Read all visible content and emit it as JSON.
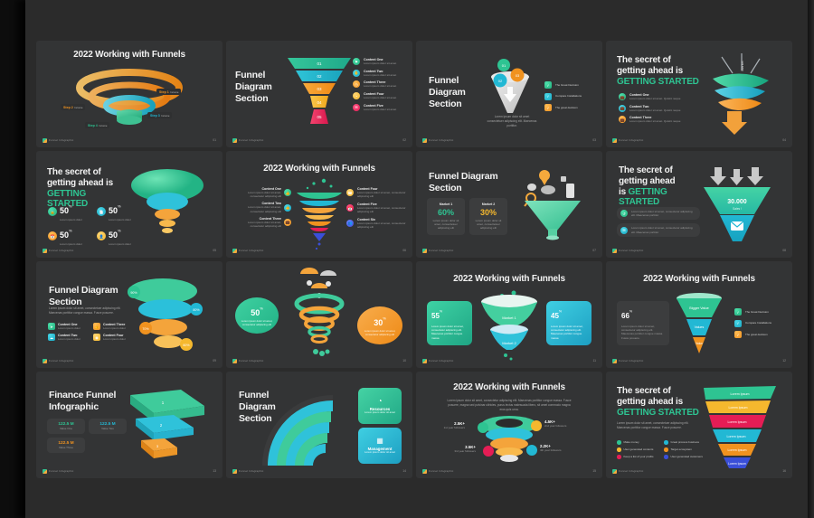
{
  "deck": {
    "footer_brand": "Funnel Infographic",
    "colors": {
      "green": "#2ec492",
      "teal": "#22b8d4",
      "orange": "#f0921f",
      "yellow": "#f5b82e",
      "pink": "#e51d55",
      "blue": "#3a4fd8",
      "slide_bg": "#333435",
      "page_bg": "#2b2b2b"
    },
    "lorem_short": "Lorem ipsum dolor sit amet",
    "lorem_mid": "Lorem ipsum dolor sit amet, consectetur adipiscing elit.",
    "lorem_long": "Lorem ipsum dolor sit amet, consectetur adipiscing elit. Maecenas porttitor congue massa. Fusce posuere."
  },
  "slides": [
    {
      "n": 1,
      "page": "01",
      "title": "2022 Working with Funnels",
      "ring_labels": [
        {
          "text": "Step 1",
          "sub": "Income",
          "color": "#f0921f"
        },
        {
          "text": "Step 2",
          "sub": "Income",
          "color": "#f0921f"
        },
        {
          "text": "Step 3",
          "sub": "Income",
          "color": "#22b8d4"
        },
        {
          "text": "Step 4",
          "sub": "Income",
          "color": "#2ec492"
        }
      ]
    },
    {
      "n": 2,
      "page": "02",
      "title": "Funnel Diagram Section",
      "steps": [
        "01",
        "02",
        "03",
        "04",
        "05"
      ],
      "legend": [
        {
          "label": "Content One",
          "desc": "Lorem ipsum dolor sit amet",
          "color": "#2ec492",
          "icon": "⚑"
        },
        {
          "label": "Content Two",
          "desc": "Lorem ipsum dolor sit amet",
          "color": "#22b8d4",
          "icon": "✋"
        },
        {
          "label": "Content Three",
          "desc": "Lorem ipsum dolor sit amet",
          "color": "#f0921f",
          "icon": "◴"
        },
        {
          "label": "Content Four",
          "desc": "Lorem ipsum dolor sit amet",
          "color": "#f5b82e",
          "icon": "◔"
        },
        {
          "label": "Content Five",
          "desc": "Lorem ipsum dolor sit amet",
          "color": "#e51d55",
          "icon": "✉"
        }
      ]
    },
    {
      "n": 3,
      "page": "03",
      "title": "Funnel Diagram Section",
      "caption": "Lorem ipsum dolor sit amet consectetuer adipiscing elit. Maecenas porttitor.",
      "bubbles": [
        {
          "label": "01",
          "color": "#2ec492"
        },
        {
          "label": "02",
          "color": "#22b8d4"
        },
        {
          "label": "03",
          "color": "#f0921f"
        }
      ],
      "legend": [
        {
          "label": "The Great Decision",
          "color": "#2ec492"
        },
        {
          "label": "Compare Installations",
          "color": "#22b8d4"
        },
        {
          "label": "The great decision",
          "color": "#f0921f"
        }
      ]
    },
    {
      "n": 4,
      "page": "04",
      "title_1": "The secret of getting",
      "title_2": "ahead is ",
      "title_accent": "GETTING STARTED",
      "vertical_label": "Market",
      "legend": [
        {
          "label": "Content One",
          "desc": "Lorem ipsum dolor sit amet. Quisint neque",
          "color": "#2ec492"
        },
        {
          "label": "Content Two",
          "desc": "Lorem ipsum dolor sit amet. Quisint neque",
          "color": "#22b8d4"
        },
        {
          "label": "Content Three",
          "desc": "Lorem ipsum dolor sit amet. Quisint neque",
          "color": "#f0921f"
        }
      ]
    },
    {
      "n": 5,
      "page": "05",
      "title_1": "The secret of getting",
      "title_2": "ahead is ",
      "title_accent": "GETTING STARTED",
      "stats": [
        {
          "value": "50",
          "unit": "%",
          "desc": "Lorem ipsum dolor",
          "color": "#2ec492"
        },
        {
          "value": "50",
          "unit": "%",
          "desc": "Lorem ipsum dolor",
          "color": "#22b8d4"
        },
        {
          "value": "50",
          "unit": "%",
          "desc": "Lorem ipsum dolor",
          "color": "#f0921f"
        },
        {
          "value": "50",
          "unit": "%",
          "desc": "Lorem ipsum dolor",
          "color": "#f5b82e"
        }
      ]
    },
    {
      "n": 6,
      "page": "06",
      "title": "2022 Working with Funnels",
      "left": [
        {
          "label": "Content One",
          "desc": "Lorem ipsum dolor sit amet, consectetur adipiscing elit",
          "color": "#2ec492"
        },
        {
          "label": "Content Two",
          "desc": "Lorem ipsum dolor sit amet, consectetur adipiscing elit",
          "color": "#22b8d4"
        },
        {
          "label": "Content Three",
          "desc": "Lorem ipsum dolor sit amet, consectetur adipiscing elit",
          "color": "#f0921f"
        }
      ],
      "right": [
        {
          "label": "Content Four",
          "desc": "Lorem ipsum dolor sit amet, consectetur adipiscing elit",
          "color": "#f5b82e"
        },
        {
          "label": "Content Five",
          "desc": "Lorem ipsum dolor sit amet, consectetur adipiscing elit",
          "color": "#e51d55"
        },
        {
          "label": "Content Six",
          "desc": "Lorem ipsum dolor sit amet, consectetur adipiscing elit",
          "color": "#3a4fd8"
        }
      ]
    },
    {
      "n": 7,
      "page": "07",
      "title": "Funnel Diagram Section",
      "markets": [
        {
          "name": "Market 1",
          "value": "60%",
          "color": "#2ec492",
          "desc": "Lorem ipsum dolor sit amet, consectetuer adipiscing elit"
        },
        {
          "name": "Market 2",
          "value": "30%",
          "color": "#f5b82e",
          "desc": "Lorem ipsum dolor sit amet, consectetuer adipiscing elit"
        }
      ]
    },
    {
      "n": 8,
      "page": "08",
      "title_1": "The secret of",
      "title_2": "getting ahead",
      "title_3": "is ",
      "title_accent": "GETTING STARTED",
      "funnel_value": "30.000",
      "funnel_sub": "Sales !",
      "items": [
        {
          "desc": "Lorem ipsum dolor sit amet, consectetur adipiscing elit. Maecenas porttitor",
          "color": "#2ec492",
          "icon": "↺"
        },
        {
          "desc": "Lorem ipsum dolor sit amet, consectetur adipiscing elit. Maecenas porttitor",
          "color": "#22b8d4",
          "icon": "✉"
        }
      ]
    },
    {
      "n": 9,
      "page": "09",
      "title": "Funnel Diagram Section",
      "caption": "Lorem ipsum dolor sit amet, consectetuer adipiscing elit. Maecenas porttitor congue massa. Fusce posuere.",
      "percents": [
        "90%",
        "80%",
        "70%",
        "60%"
      ],
      "legend": [
        {
          "label": "Content One",
          "desc": "Lorem ipsum dolor",
          "color": "#2ec492"
        },
        {
          "label": "Content Three",
          "desc": "Lorem ipsum dolor",
          "color": "#f0921f"
        },
        {
          "label": "Content Two",
          "desc": "Lorem ipsum dolor",
          "color": "#22b8d4"
        },
        {
          "label": "Content Four",
          "desc": "Lorem ipsum dolor",
          "color": "#f5b82e"
        }
      ]
    },
    {
      "n": 10,
      "page": "10",
      "left_bubble": {
        "value": "50",
        "unit": "%",
        "desc": "Lorem ipsum dolor sit amet, consectetur adipiscing elit",
        "color": "#2ec492"
      },
      "right_bubble": {
        "value": "30",
        "unit": "%",
        "desc": "Lorem ipsum dolor sit amet, consectetur adipiscing elit",
        "color": "#f0921f"
      }
    },
    {
      "n": 11,
      "page": "11",
      "title": "2022 Working with Funnels",
      "cards": [
        {
          "value": "55",
          "unit": "%",
          "desc": "Lorem ipsum dolor sit amet, consectetur adipiscing elit. Maecenas porttitor congue massa",
          "color": "#2ec492"
        },
        {
          "value": "45",
          "unit": "%",
          "desc": "Lorem ipsum dolor sit amet, consectetur adipiscing elit. Maecenas porttitor congue massa",
          "color": "#22b8d4"
        }
      ],
      "funnel_labels": [
        "Market 1",
        "Market 2"
      ]
    },
    {
      "n": 12,
      "page": "12",
      "title": "2022 Working with Funnels",
      "stat": {
        "value": "66",
        "unit": "%",
        "desc": "Lorem ipsum dolor sit amet, consectetur adipiscing elit. Maecenas porttitor congue massa. Fusce posuere."
      },
      "funnel_labels": [
        "Bigger Value",
        "Values",
        "Value"
      ],
      "legend": [
        {
          "label": "The Great Decision",
          "color": "#2ec492"
        },
        {
          "label": "Compare Installations",
          "color": "#22b8d4"
        },
        {
          "label": "The great decision",
          "color": "#f0921f"
        }
      ]
    },
    {
      "n": 13,
      "page": "13",
      "title": "Finance Funnel Infographic",
      "steps": [
        "1",
        "2",
        "3"
      ],
      "values": [
        {
          "value": "122.5 M",
          "label": "Value One",
          "color": "#2ec492"
        },
        {
          "value": "122.5 M",
          "label": "Value Two",
          "color": "#22b8d4"
        },
        {
          "value": "122.5 M",
          "label": "Value Three",
          "color": "#f0921f"
        }
      ]
    },
    {
      "n": 14,
      "page": "14",
      "title": "Funnel Diagram Section",
      "cards": [
        {
          "label": "Resources",
          "desc": "Lorem ipsum dolor sit amet",
          "color": "#2ec492",
          "icon": "◔"
        },
        {
          "label": "Management",
          "desc": "Lorem ipsum dolor sit amet",
          "color": "#22b8d4",
          "icon": "▦"
        }
      ]
    },
    {
      "n": 15,
      "page": "15",
      "title": "2022 Working with Funnels",
      "caption": "Lorem ipsum dolor sit amet, consectetur adipiscing elit. Maecenas porttitor congue massa. Fusce posuere, magna sed pulvinar ultricies, purus lectus malesuada libero, sit amet commodo magna eros quis urna.",
      "callouts": [
        {
          "value": "2.5K+",
          "label": "1st year followers",
          "color": "#2ec492"
        },
        {
          "value": "4.5K+",
          "label": "2nd year followers",
          "color": "#f5b82e"
        },
        {
          "value": "3.5K+",
          "label": "3rd year followers",
          "color": "#e51d55"
        },
        {
          "value": "2.2K+",
          "label": "4th year followers",
          "color": "#22b8d4"
        }
      ]
    },
    {
      "n": 16,
      "page": "16",
      "title_1": "The secret of getting",
      "title_2": "ahead is ",
      "title_accent": "GETTING STARTED",
      "caption": "Lorem ipsum dolor sit amet, consectetuer adipiscing elit. Maecenas porttitor congue massa. Fusce posuere.",
      "bands": [
        "Lorem Ipsum",
        "Lorem Ipsum",
        "Lorem Ipsum",
        "Lorem Ipsum",
        "Lorem Ipsum",
        "Lorem Ipsum"
      ],
      "band_colors": [
        "#2ec492",
        "#f5b82e",
        "#e51d55",
        "#22b8d4",
        "#f0921f",
        "#3a4fd8"
      ],
      "legend": [
        {
          "label": "Make money",
          "color": "#2ec492"
        },
        {
          "label": "Great process business",
          "color": "#22b8d4"
        },
        {
          "label": "User generated contents",
          "color": "#f5b82e"
        },
        {
          "label": "Target ecosystem",
          "color": "#f0921f"
        },
        {
          "label": "Keep a list of your profits",
          "color": "#e51d55"
        },
        {
          "label": "User generated customers",
          "color": "#3a4fd8"
        }
      ]
    }
  ]
}
